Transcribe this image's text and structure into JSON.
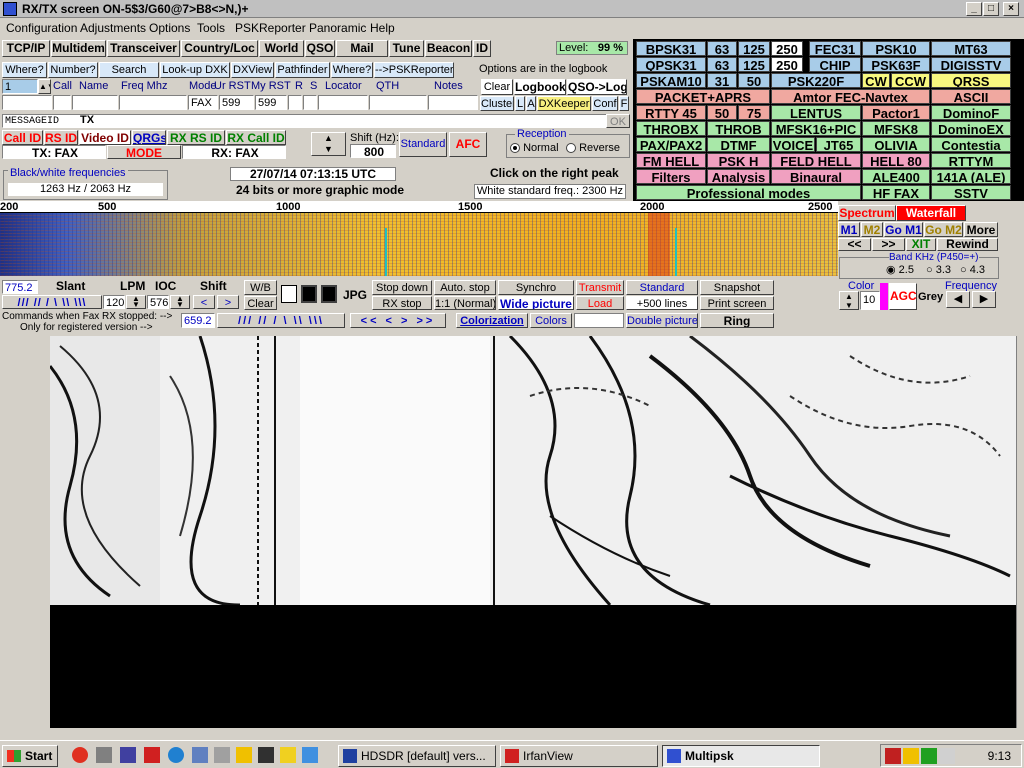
{
  "window": {
    "title": "RX/TX screen  ON-5$3/G60@7>B8<>N,)+",
    "min": "_",
    "max": "□",
    "close": "×"
  },
  "menu": [
    "Configuration",
    "Adjustments",
    "Options",
    "Tools",
    "PSKReporter",
    "Panoramic",
    "Help"
  ],
  "toolbar1": [
    "TCP/IP",
    "Multidem",
    "Transceiver",
    "Country/Loc",
    "World",
    "QSO",
    "Mail",
    "Tune",
    "Beacon",
    "ID"
  ],
  "level": {
    "label": "Level:",
    "value": "99 %"
  },
  "toolbar2": [
    "Where?",
    "Number?",
    "Search",
    "Look-up DXK",
    "DXView",
    "Pathfinder",
    "Where?",
    "-->PSKReporter"
  ],
  "logbook_note": "Options are in the logbook",
  "log_headers": [
    "Call",
    "Name",
    "Freq Mhz",
    "Mode",
    "Ur RST",
    "My RST",
    "R",
    "S",
    "Locator",
    "QTH",
    "Notes"
  ],
  "log_values": {
    "row_num": "1",
    "mode": "FAX",
    "ur_rst": "599",
    "my_rst": "599"
  },
  "log_buttons": [
    "Clear",
    "Logbook",
    "QSO->Log",
    "Cluster",
    "L",
    "A",
    "DXKeeper",
    "Conf",
    "F"
  ],
  "messageid": {
    "label": "MESSAGEID",
    "tx": "TX",
    "ok": "OK"
  },
  "id_buttons": {
    "call_id": "Call ID",
    "rs_id": "RS ID",
    "video_id": "Video ID",
    "qrgs": "QRGs",
    "rx_rs_id": "RX RS ID",
    "rx_call_id": "RX Call ID"
  },
  "tx_mode": "TX: FAX",
  "rx_mode": "RX: FAX",
  "mode_label": "MODE",
  "shift": {
    "label": "Shift (Hz):",
    "value": "800",
    "standard": "Standard",
    "afc": "AFC"
  },
  "reception": {
    "title": "Reception",
    "normal": "Normal",
    "reverse": "Reverse"
  },
  "bw_freq": {
    "title": "Black/white frequencies",
    "value": "1263 Hz / 2063 Hz"
  },
  "datetime": "27/07/14 07:13:15 UTC",
  "graphic_mode": "24 bits or more graphic mode",
  "peak_note": "Click on the right peak",
  "white_std": "White standard freq.: 2300 Hz",
  "modes": [
    [
      "BPSK31",
      "63",
      "125",
      "250",
      "FEC31",
      "PSK10",
      "MT63"
    ],
    [
      "QPSK31",
      "63",
      "125",
      "250",
      "CHIP",
      "PSK63F",
      "DIGISSTV"
    ],
    [
      "PSKAM10",
      "31",
      "50",
      "PSK220F",
      "CW",
      "CCW",
      "QRSS"
    ],
    [
      "PACKET+APRS",
      "Amtor FEC-Navtex",
      "ASCII"
    ],
    [
      "RTTY 45",
      "50",
      "75",
      "LENTUS",
      "Pactor1",
      "DominoF"
    ],
    [
      "THROBX",
      "THROB",
      "MFSK16+PIC",
      "MFSK8",
      "DominoEX"
    ],
    [
      "PAX/PAX2",
      "DTMF",
      "VOICE",
      "JT65",
      "OLIVIA",
      "Contestia"
    ],
    [
      "FM HELL",
      "PSK H",
      "FELD HELL",
      "HELL 80",
      "RTTYM"
    ],
    [
      "Filters",
      "Analysis",
      "Binaural",
      "ALE400",
      "141A (ALE)"
    ],
    [
      "Professional modes",
      "HF FAX",
      "SSTV"
    ]
  ],
  "scale": [
    "200",
    "500",
    "1000",
    "1500",
    "2000",
    "2500"
  ],
  "spec_controls": {
    "spectrum": "Spectrum",
    "waterfall": "Waterfall",
    "m1": "M1",
    "m2": "M2",
    "gom1": "Go M1",
    "gom2": "Go M2",
    "more": "More",
    "prev": "<<",
    "next": ">>",
    "xit": "XIT",
    "rewind": "Rewind",
    "band": "Band KHz (P450=+)",
    "b25": "2.5",
    "b33": "3.3",
    "b43": "4.3",
    "color": "Color",
    "color_val": "10",
    "agc": "AGC",
    "grey": "Grey",
    "frequency": "Frequency"
  },
  "fax_controls": {
    "val1": "775.2",
    "slant": "Slant",
    "lpm": "LPM",
    "lpm_val": "120",
    "ioc": "IOC",
    "ioc_val": "576",
    "shift": "Shift",
    "wb": "W/B",
    "clear": "Clear",
    "jpg": "JPG",
    "stop_down": "Stop down",
    "rx_stop": "RX stop",
    "auto_stop": "Auto. stop",
    "ratio": "1:1 (Normal)",
    "synchro": "Synchro",
    "wide": "Wide picture",
    "transmit": "Transmit",
    "load": "Load",
    "standard": "Standard",
    "plus500": "+500 lines",
    "snapshot": "Snapshot",
    "print": "Print screen",
    "colorization": "Colorization",
    "colors": "Colors",
    "double": "Double picture",
    "ring": "Ring",
    "val2": "659.2",
    "note1": "Commands when Fax RX stopped: -->",
    "note2": "Only for registered version -->"
  },
  "taskbar": {
    "start": "Start",
    "tasks": [
      "HDSDR [default]  vers...",
      "IrfanView",
      "Multipsk"
    ],
    "clock": "9:13"
  },
  "colors": {
    "title_bg": "#c0c0c0",
    "red": "#ff0000",
    "blue": "#0000c0",
    "green": "#008000"
  }
}
